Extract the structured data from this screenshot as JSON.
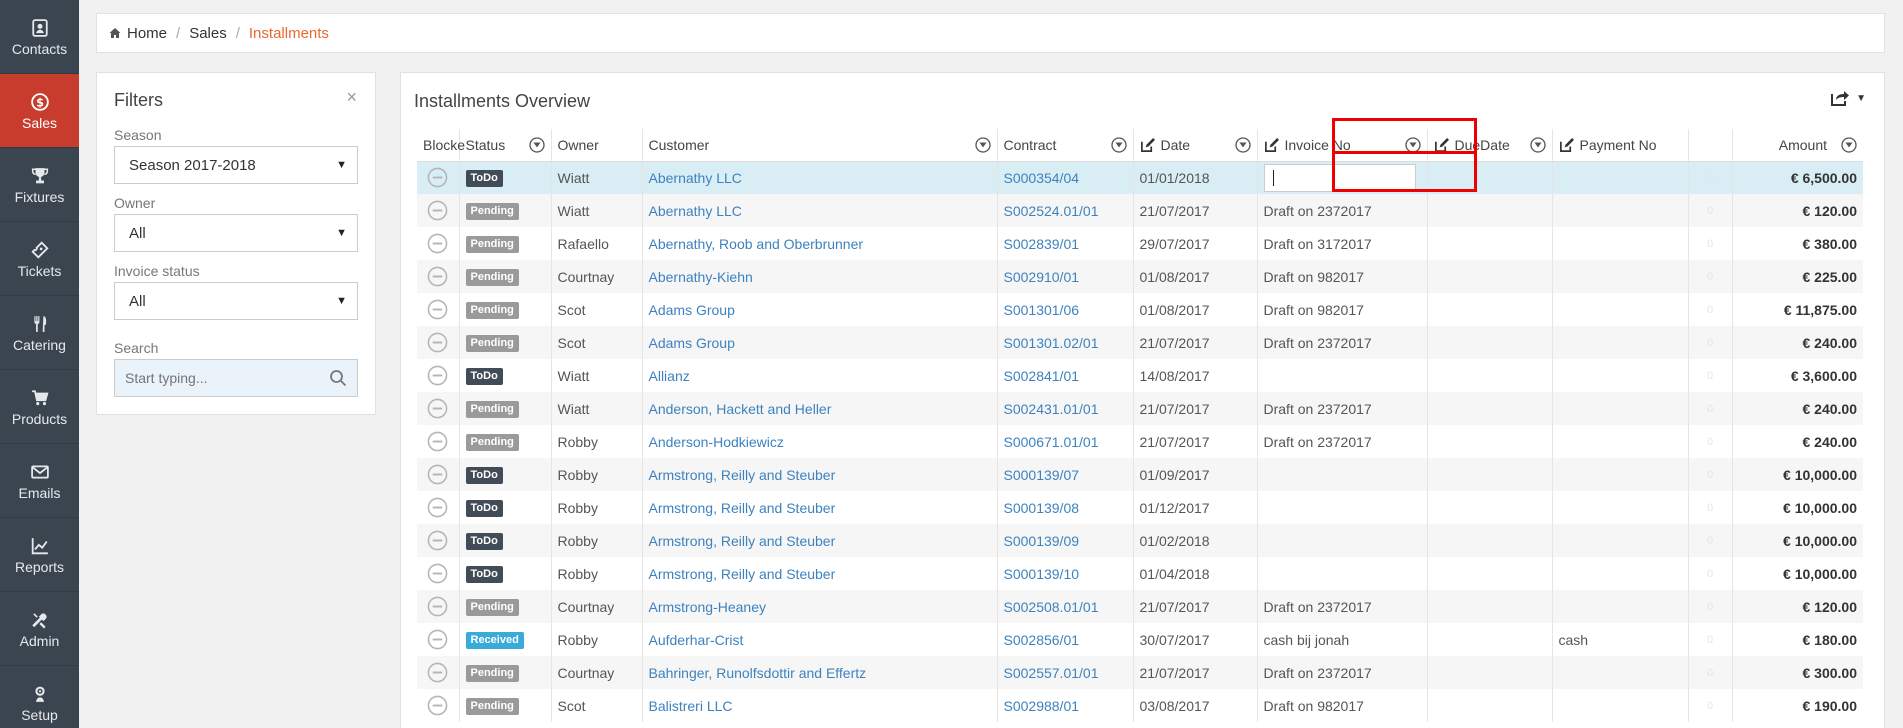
{
  "sidebar": {
    "items": [
      {
        "label": "Contacts",
        "icon": "contacts-icon"
      },
      {
        "label": "Sales",
        "icon": "dollar-icon",
        "active": true
      },
      {
        "label": "Fixtures",
        "icon": "trophy-icon"
      },
      {
        "label": "Tickets",
        "icon": "ticket-icon"
      },
      {
        "label": "Catering",
        "icon": "cutlery-icon"
      },
      {
        "label": "Products",
        "icon": "cart-icon"
      },
      {
        "label": "Emails",
        "icon": "envelope-icon"
      },
      {
        "label": "Reports",
        "icon": "chart-icon"
      },
      {
        "label": "Admin",
        "icon": "tools-icon"
      },
      {
        "label": "Setup",
        "icon": "gear-icon"
      }
    ]
  },
  "breadcrumb": {
    "home": "Home",
    "section": "Sales",
    "current": "Installments"
  },
  "filters": {
    "title": "Filters",
    "close": "×",
    "season_label": "Season",
    "season_value": "Season 2017-2018",
    "owner_label": "Owner",
    "owner_value": "All",
    "invoice_status_label": "Invoice status",
    "invoice_status_value": "All",
    "search_label": "Search",
    "search_placeholder": "Start typing..."
  },
  "panel": {
    "title": "Installments Overview"
  },
  "columns": {
    "blocked": "Blocke",
    "status": "Status",
    "owner": "Owner",
    "customer": "Customer",
    "contract": "Contract",
    "date": "Date",
    "invoice_no": "Invoice No",
    "due_date": "DueDate",
    "payment_no": "Payment No",
    "amount": "Amount"
  },
  "rows": [
    {
      "status": "ToDo",
      "owner": "Wiatt",
      "customer": "Abernathy LLC",
      "contract": "S000354/04",
      "date": "01/01/2018",
      "invoice": "",
      "due": "",
      "payment": "",
      "zero": "0",
      "amount": "€ 6,500.00"
    },
    {
      "status": "Pending",
      "owner": "Wiatt",
      "customer": "Abernathy LLC",
      "contract": "S002524.01/01",
      "date": "21/07/2017",
      "invoice": "Draft on 2372017",
      "due": "",
      "payment": "",
      "zero": "0",
      "amount": "€ 120.00"
    },
    {
      "status": "Pending",
      "owner": "Rafaello",
      "customer": "Abernathy, Roob and Oberbrunner",
      "contract": "S002839/01",
      "date": "29/07/2017",
      "invoice": "Draft on 3172017",
      "due": "",
      "payment": "",
      "zero": "0",
      "amount": "€ 380.00"
    },
    {
      "status": "Pending",
      "owner": "Courtnay",
      "customer": "Abernathy-Kiehn",
      "contract": "S002910/01",
      "date": "01/08/2017",
      "invoice": "Draft on 982017",
      "due": "",
      "payment": "",
      "zero": "0",
      "amount": "€ 225.00"
    },
    {
      "status": "Pending",
      "owner": "Scot",
      "customer": "Adams Group",
      "contract": "S001301/06",
      "date": "01/08/2017",
      "invoice": "Draft on 982017",
      "due": "",
      "payment": "",
      "zero": "0",
      "amount": "€ 11,875.00"
    },
    {
      "status": "Pending",
      "owner": "Scot",
      "customer": "Adams Group",
      "contract": "S001301.02/01",
      "date": "21/07/2017",
      "invoice": "Draft on 2372017",
      "due": "",
      "payment": "",
      "zero": "0",
      "amount": "€ 240.00"
    },
    {
      "status": "ToDo",
      "owner": "Wiatt",
      "customer": "Allianz",
      "contract": "S002841/01",
      "date": "14/08/2017",
      "invoice": "",
      "due": "",
      "payment": "",
      "zero": "0",
      "amount": "€ 3,600.00"
    },
    {
      "status": "Pending",
      "owner": "Wiatt",
      "customer": "Anderson, Hackett and Heller",
      "contract": "S002431.01/01",
      "date": "21/07/2017",
      "invoice": "Draft on 2372017",
      "due": "",
      "payment": "",
      "zero": "0",
      "amount": "€ 240.00"
    },
    {
      "status": "Pending",
      "owner": "Robby",
      "customer": "Anderson-Hodkiewicz",
      "contract": "S000671.01/01",
      "date": "21/07/2017",
      "invoice": "Draft on 2372017",
      "due": "",
      "payment": "",
      "zero": "0",
      "amount": "€ 240.00"
    },
    {
      "status": "ToDo",
      "owner": "Robby",
      "customer": "Armstrong, Reilly and Steuber",
      "contract": "S000139/07",
      "date": "01/09/2017",
      "invoice": "",
      "due": "",
      "payment": "",
      "zero": "0",
      "amount": "€ 10,000.00"
    },
    {
      "status": "ToDo",
      "owner": "Robby",
      "customer": "Armstrong, Reilly and Steuber",
      "contract": "S000139/08",
      "date": "01/12/2017",
      "invoice": "",
      "due": "",
      "payment": "",
      "zero": "0",
      "amount": "€ 10,000.00"
    },
    {
      "status": "ToDo",
      "owner": "Robby",
      "customer": "Armstrong, Reilly and Steuber",
      "contract": "S000139/09",
      "date": "01/02/2018",
      "invoice": "",
      "due": "",
      "payment": "",
      "zero": "0",
      "amount": "€ 10,000.00"
    },
    {
      "status": "ToDo",
      "owner": "Robby",
      "customer": "Armstrong, Reilly and Steuber",
      "contract": "S000139/10",
      "date": "01/04/2018",
      "invoice": "",
      "due": "",
      "payment": "",
      "zero": "0",
      "amount": "€ 10,000.00"
    },
    {
      "status": "Pending",
      "owner": "Courtnay",
      "customer": "Armstrong-Heaney",
      "contract": "S002508.01/01",
      "date": "21/07/2017",
      "invoice": "Draft on 2372017",
      "due": "",
      "payment": "",
      "zero": "0",
      "amount": "€ 120.00"
    },
    {
      "status": "Received",
      "owner": "Robby",
      "customer": "Aufderhar-Crist",
      "contract": "S002856/01",
      "date": "30/07/2017",
      "invoice": "cash bij jonah",
      "due": "",
      "payment": "cash",
      "zero": "0",
      "amount": "€ 180.00"
    },
    {
      "status": "Pending",
      "owner": "Courtnay",
      "customer": "Bahringer, Runolfsdottir and Effertz",
      "contract": "S002557.01/01",
      "date": "21/07/2017",
      "invoice": "Draft on 2372017",
      "due": "",
      "payment": "",
      "zero": "0",
      "amount": "€ 300.00"
    },
    {
      "status": "Pending",
      "owner": "Scot",
      "customer": "Balistreri LLC",
      "contract": "S002988/01",
      "date": "03/08/2017",
      "invoice": "Draft on 982017",
      "due": "",
      "payment": "",
      "zero": "0",
      "amount": "€ 190.00"
    }
  ]
}
